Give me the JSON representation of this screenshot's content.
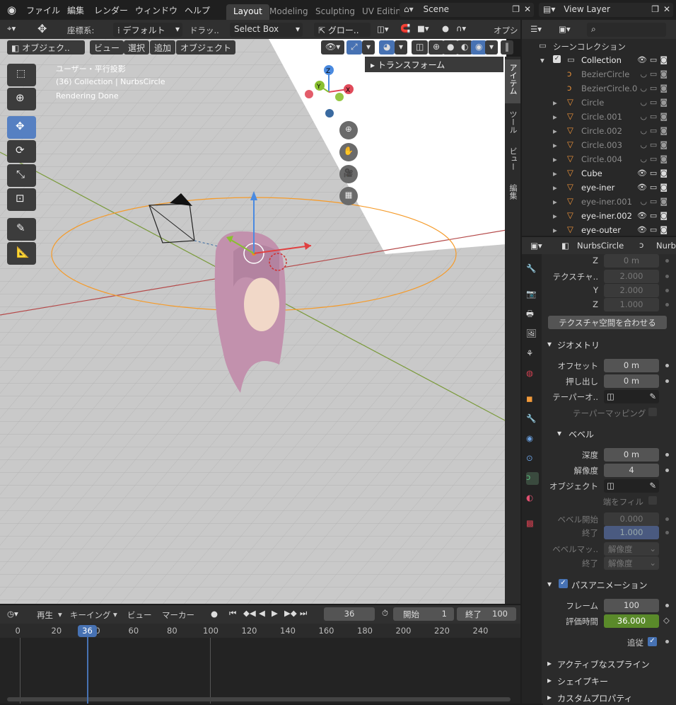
{
  "menu": [
    "ファイル",
    "編集",
    "レンダー",
    "ウィンドウ",
    "ヘルプ"
  ],
  "workspaces": [
    "Layout",
    "Modeling",
    "Sculpting",
    "UV Editin"
  ],
  "scene": "Scene",
  "view_layer": "View Layer",
  "toolbar": {
    "coord_label": "座標系:",
    "coord_value": "デフォルト",
    "drag_label": "ドラッ..",
    "select_mode": "Select Box",
    "orient": "グロー..",
    "options": "オプシ"
  },
  "viewport_header": {
    "mode": "オブジェク..",
    "view": "ビュー",
    "select": "選択",
    "add": "追加",
    "object": "オブジェクト"
  },
  "overlay_text": {
    "line1": "ユーザー・平行投影",
    "line2": "(36) Collection | NurbsCircle",
    "line3": "Rendering Done"
  },
  "npanel": {
    "transform": "トランスフォーム",
    "tabs": [
      "アイテム",
      "ツール",
      "ビュー",
      "編集"
    ]
  },
  "gizmo": {
    "z": "Z",
    "y": "Y",
    "x": "X"
  },
  "outliner": {
    "scene_collection": "シーンコレクション",
    "collection": "Collection",
    "items": [
      {
        "name": "BezierCircle",
        "dim": true
      },
      {
        "name": "BezierCircle.0",
        "dim": true
      },
      {
        "name": "Circle",
        "dim": true
      },
      {
        "name": "Circle.001",
        "dim": true
      },
      {
        "name": "Circle.002",
        "dim": true
      },
      {
        "name": "Circle.003",
        "dim": true
      },
      {
        "name": "Circle.004",
        "dim": true
      },
      {
        "name": "Cube",
        "dim": false
      },
      {
        "name": "eye-iner",
        "dim": false
      },
      {
        "name": "eye-iner.001",
        "dim": true
      },
      {
        "name": "eye-iner.002",
        "dim": false
      },
      {
        "name": "eye-outer",
        "dim": false
      }
    ]
  },
  "properties": {
    "object_name": "NurbsCircle",
    "data_name": "Nurbs",
    "tex_rows": [
      {
        "label": "Z",
        "value": "0 m"
      },
      {
        "label": "テクスチャ..",
        "value": "2.000"
      },
      {
        "label": "Y",
        "value": "2.000"
      },
      {
        "label": "Z",
        "value": "1.000"
      }
    ],
    "match_texture": "テクスチャ空間を合わせる",
    "geometry": {
      "title": "ジオメトリ",
      "offset_label": "オフセット",
      "offset": "0 m",
      "extrude_label": "押し出し",
      "extrude": "0 m",
      "taper_label": "テーパーオ..",
      "taper_map": "テーパーマッピング"
    },
    "bevel": {
      "title": "ベベル",
      "depth_label": "深度",
      "depth": "0 m",
      "res_label": "解像度",
      "res": "4",
      "object_label": "オブジェクト",
      "fill_caps": "端をフィル",
      "start_label": "ベベル開始",
      "start": "0.000",
      "end_label": "終了",
      "end": "1.000",
      "map_label": "ベベルマッ..",
      "map_value": "解像度",
      "map_end_label": "終了",
      "map_end_value": "解像度"
    },
    "path_anim": {
      "title": "パスアニメーション",
      "frames_label": "フレーム",
      "frames": "100",
      "eval_label": "評価時間",
      "eval": "36.000",
      "follow_label": "追従"
    },
    "collapsed": [
      "アクティブなスプライン",
      "シェイプキー",
      "カスタムプロパティ"
    ]
  },
  "timeline": {
    "play": "再生",
    "keying": "キーイング",
    "view": "ビュー",
    "marker": "マーカー",
    "current": "36",
    "start_label": "開始",
    "start": "1",
    "end_label": "終了",
    "end": "100",
    "ticks": [
      "0",
      "20",
      "40",
      "60",
      "80",
      "100",
      "120",
      "140",
      "160",
      "180",
      "200",
      "220",
      "240"
    ]
  }
}
